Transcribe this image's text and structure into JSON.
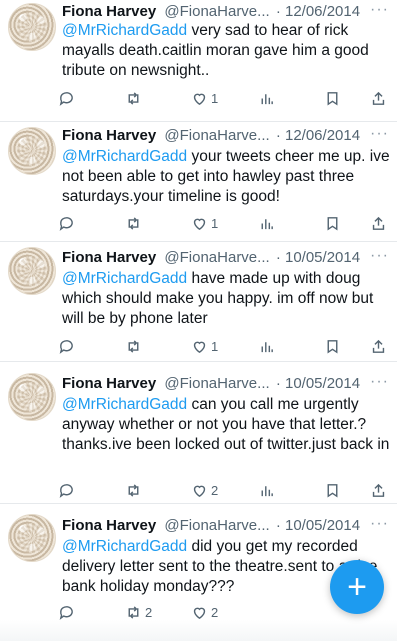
{
  "tweets": [
    {
      "name": "Fiona Harvey",
      "handle": "@FionaHarve...",
      "date": "· 12/06/2014",
      "mention": "",
      "text": "@MrRichardGadd very sad to hear of rick mayalls death.caitlin moran gave him a good tribute on newsnight..",
      "reply_count": "",
      "retweet_count": "",
      "like_count": "1"
    },
    {
      "name": "Fiona Harvey",
      "handle": "@FionaHarve...",
      "date": "· 12/06/2014",
      "mention": "@MrRichardGadd",
      "text": " your tweets cheer me up. ive not been able to get into hawley past three saturdays.your timeline is good!",
      "reply_count": "",
      "retweet_count": "",
      "like_count": "1"
    },
    {
      "name": "Fiona Harvey",
      "handle": "@FionaHarve...",
      "date": "· 10/05/2014",
      "mention": "@MrRichardGadd",
      "text": " have made up with doug which should make you happy. im off now but will be by phone later",
      "reply_count": "",
      "retweet_count": "",
      "like_count": "1"
    },
    {
      "name": "Fiona Harvey",
      "handle": "@FionaHarve...",
      "date": "· 10/05/2014",
      "mention": "@MrRichardGadd",
      "text": " can you call me urgently anyway whether or not you have that letter.? thanks.ive been locked out of twitter.just back in",
      "reply_count": "",
      "retweet_count": "",
      "like_count": "2"
    },
    {
      "name": "Fiona Harvey",
      "handle": "@FionaHarve...",
      "date": "· 10/05/2014",
      "mention": "@MrRichardGadd",
      "text": " did you get my recorded delivery letter sent to the theatre.sent to arrive bank holiday monday???",
      "reply_count": "",
      "retweet_count": "2",
      "like_count": "2"
    }
  ],
  "more_label": "···",
  "compose_label": "+",
  "colors": {
    "accent": "#1d9bf0",
    "muted": "#536471"
  },
  "icons": [
    "reply-icon",
    "retweet-icon",
    "like-icon",
    "views-icon",
    "bookmark-icon",
    "share-icon"
  ]
}
